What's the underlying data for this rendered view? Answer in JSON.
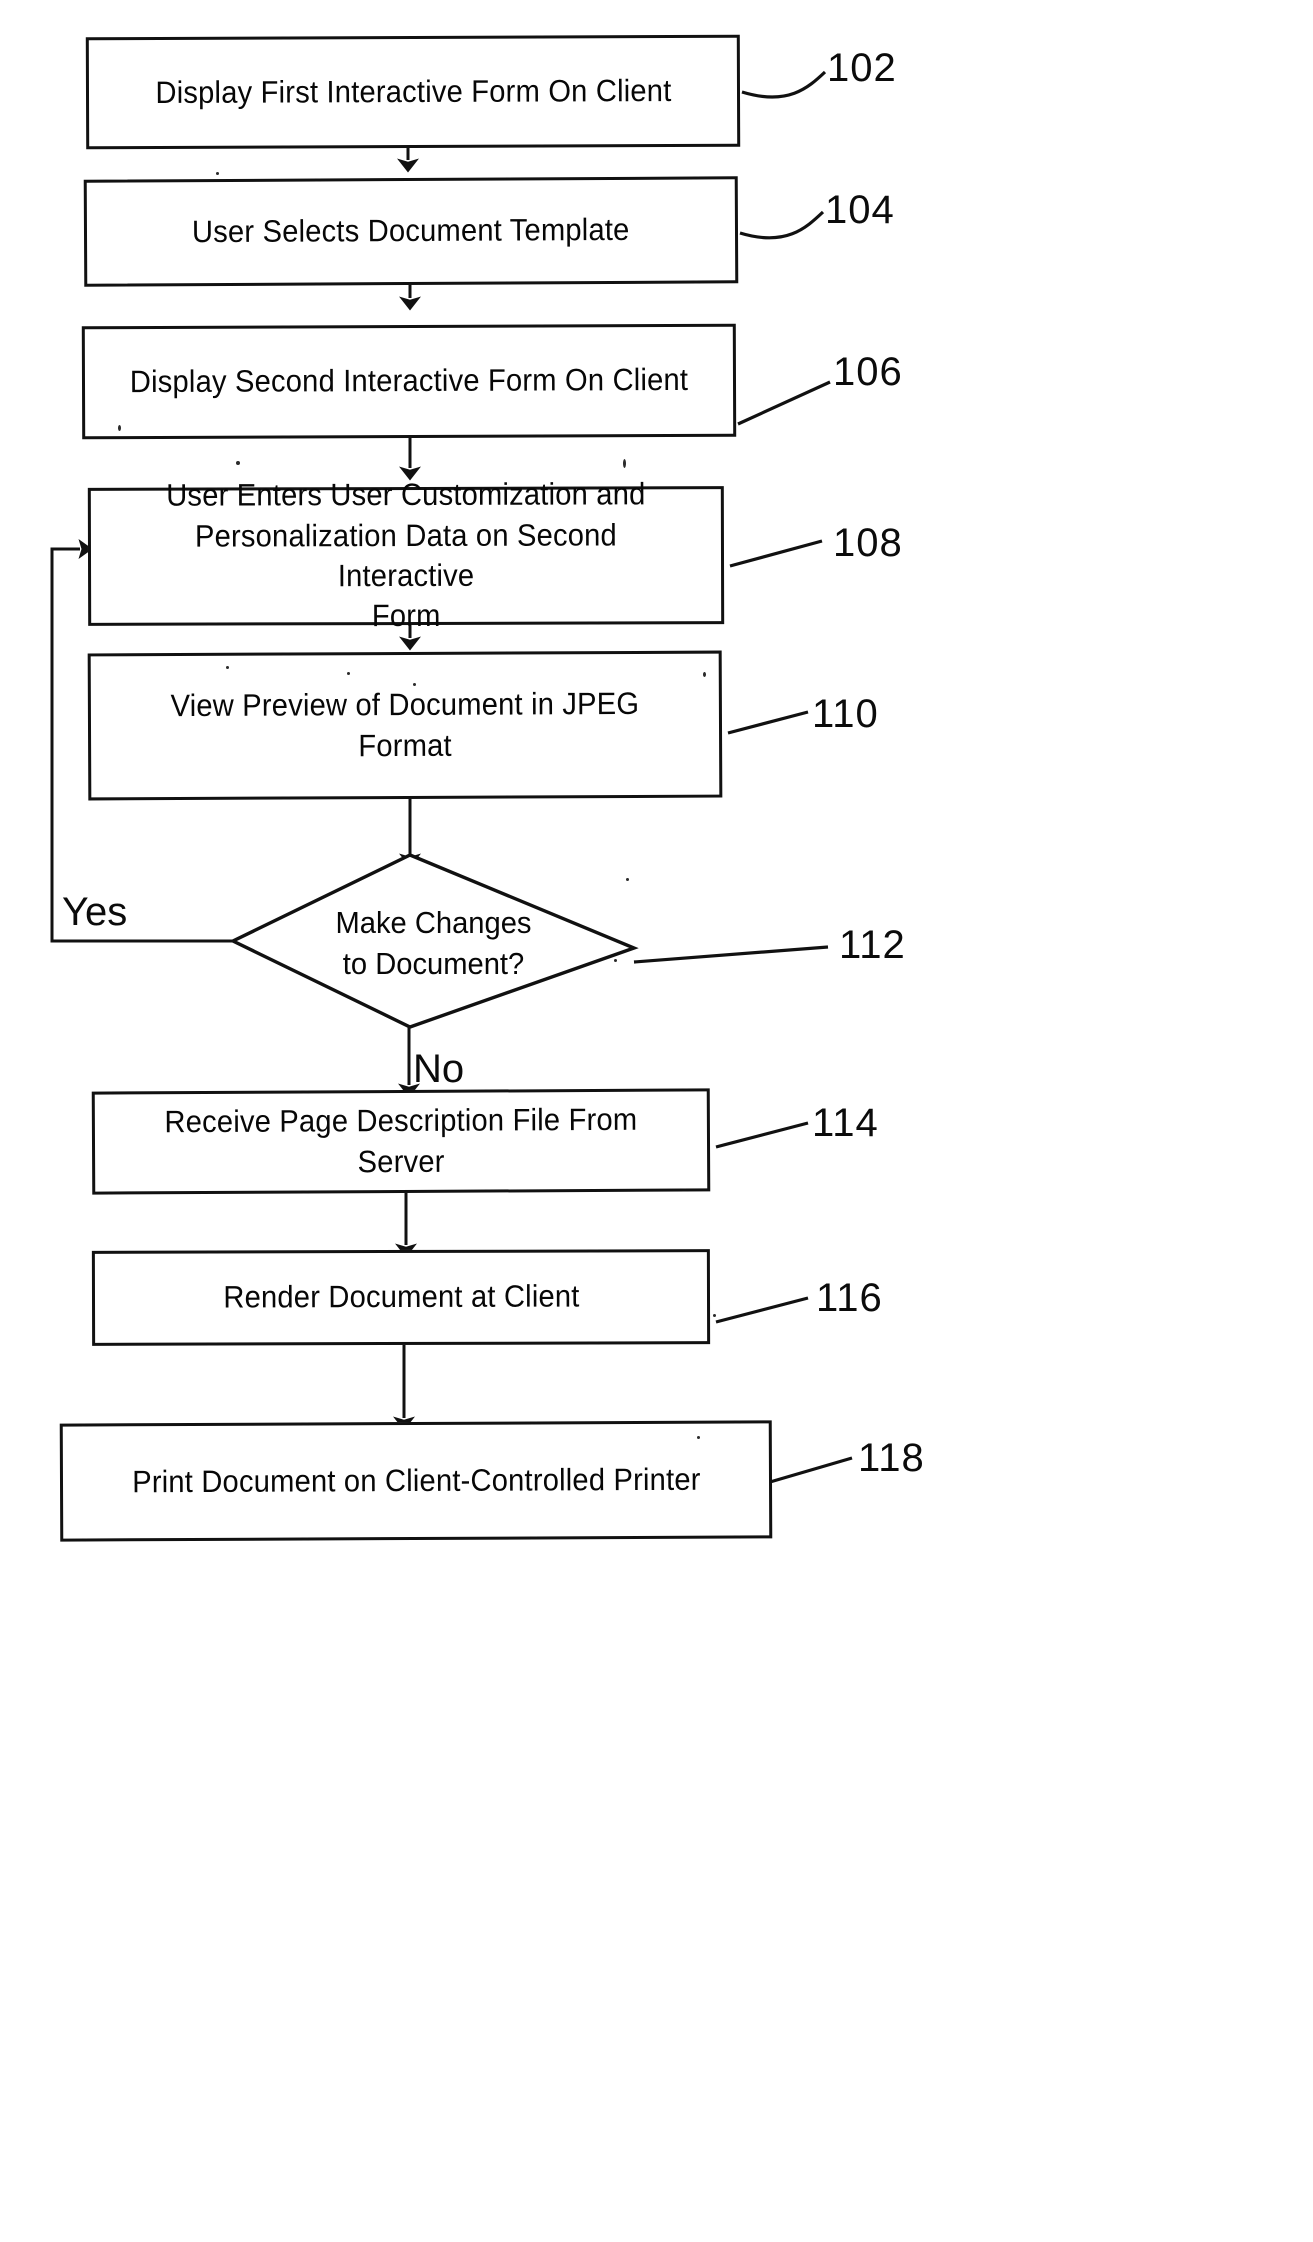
{
  "figure": {
    "type": "patent-flowchart",
    "orientation": "vertical",
    "background_color": "#ffffff",
    "line_color": "#111111"
  },
  "nodes": [
    {
      "ref": "102",
      "shape": "process",
      "label": "Display First Interactive Form On Client"
    },
    {
      "ref": "104",
      "shape": "process",
      "label": "User Selects Document Template"
    },
    {
      "ref": "106",
      "shape": "process",
      "label": "Display Second Interactive Form On Client"
    },
    {
      "ref": "108",
      "shape": "process",
      "label": "User Enters User Customization and\nPersonalization Data on Second Interactive\nForm"
    },
    {
      "ref": "110",
      "shape": "process",
      "label": "View Preview of Document in JPEG Format"
    },
    {
      "ref": "112",
      "shape": "decision",
      "label": "Make Changes\nto Document?"
    },
    {
      "ref": "114",
      "shape": "process",
      "label": "Receive Page Description File From Server"
    },
    {
      "ref": "116",
      "shape": "process",
      "label": "Render Document at Client"
    },
    {
      "ref": "118",
      "shape": "process",
      "label": "Print Document on Client-Controlled Printer"
    }
  ],
  "branch_labels": {
    "yes": "Yes",
    "no": "No"
  },
  "reference_numerals": {
    "n102": "102",
    "n104": "104",
    "n106": "106",
    "n108": "108",
    "n110": "110",
    "n112": "112",
    "n114": "114",
    "n116": "116",
    "n118": "118"
  },
  "flow": [
    {
      "from": "102",
      "to": "104",
      "label": ""
    },
    {
      "from": "104",
      "to": "106",
      "label": ""
    },
    {
      "from": "106",
      "to": "108",
      "label": ""
    },
    {
      "from": "108",
      "to": "110",
      "label": ""
    },
    {
      "from": "110",
      "to": "112",
      "label": ""
    },
    {
      "from": "112",
      "to": "108",
      "label": "Yes"
    },
    {
      "from": "112",
      "to": "114",
      "label": "No"
    },
    {
      "from": "114",
      "to": "116",
      "label": ""
    },
    {
      "from": "116",
      "to": "118",
      "label": ""
    }
  ]
}
